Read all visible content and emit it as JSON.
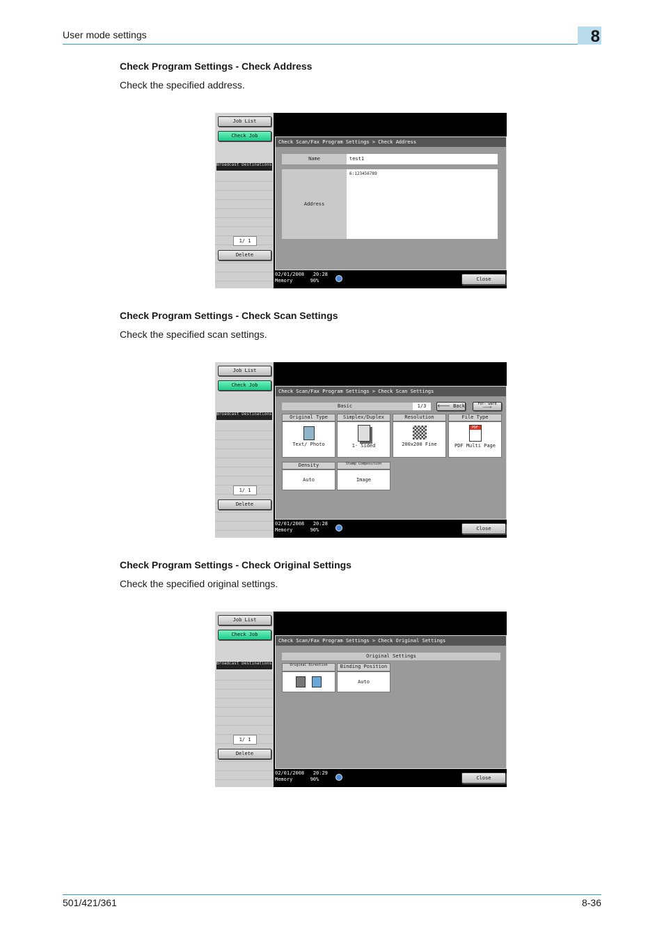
{
  "header": {
    "section": "User mode settings",
    "chapter": "8"
  },
  "sections": [
    {
      "title": "Check Program Settings - Check Address",
      "desc": "Check the specified address."
    },
    {
      "title": "Check Program Settings - Check Scan Settings",
      "desc": "Check the specified scan settings."
    },
    {
      "title": "Check Program Settings - Check Original Settings",
      "desc": "Check the specified original settings."
    }
  ],
  "sidebar": {
    "job_list": "Job List",
    "check_job": "Check Job",
    "broadcast": "Broadcast Destinations",
    "page": "1/   1",
    "delete": "Delete"
  },
  "screen1": {
    "crumb": "Check Scan/Fax Program Settings > Check Address",
    "name_label": "Name",
    "name_value": "test1",
    "address_label": "Address",
    "address_value": "6:123456789",
    "date": "02/01/2008",
    "time": "20:28",
    "memory_label": "Memory",
    "memory": "90%",
    "close": "Close"
  },
  "screen2": {
    "crumb": "Check Scan/Fax Program Settings > Check Scan Settings",
    "tab": "Basic",
    "page": "1/3",
    "back": "Back",
    "forward": "For- ward",
    "tiles": [
      {
        "head": "Original Type",
        "value": "Text/ Photo"
      },
      {
        "head": "Simplex/Duplex",
        "value": "1- Sided"
      },
      {
        "head": "Resolution",
        "value": "200x200 Fine"
      },
      {
        "head": "File Type",
        "value": "PDF Multi Page"
      },
      {
        "head": "Density",
        "value": "Auto"
      },
      {
        "head": "Stamp Composition",
        "value": "Image"
      }
    ],
    "pdf_badge": "PDF",
    "date": "02/01/2008",
    "time": "20:28",
    "memory_label": "Memory",
    "memory": "90%",
    "close": "Close"
  },
  "screen3": {
    "crumb": "Check Scan/Fax Program Settings > Check Original Settings",
    "heading": "Original Settings",
    "tiles": [
      {
        "head": "Original Direction",
        "value": ""
      },
      {
        "head": "Binding Position",
        "value": "Auto"
      }
    ],
    "date": "02/01/2008",
    "time": "20:29",
    "memory_label": "Memory",
    "memory": "90%",
    "close": "Close"
  },
  "footer": {
    "model": "501/421/361",
    "page": "8-36"
  }
}
